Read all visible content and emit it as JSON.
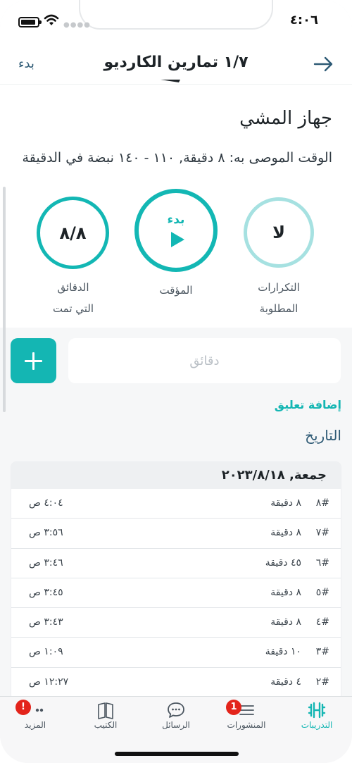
{
  "status_bar": {
    "time": "٤:٠٦"
  },
  "header": {
    "title": "١/٧ تمارين الكارديو",
    "start_label": "بدء"
  },
  "exercise": {
    "name": "جهاز المشي",
    "recommended": "الوقت الموصى به: ٨ دقيقة, ١١٠ - ١٤٠ نبضة في الدقيقة"
  },
  "stats": {
    "reps_value": "لا",
    "reps_caption_line1": "التكرارات",
    "reps_caption_line2": "المطلوبة",
    "timer_label": "بدء",
    "timer_caption": "المؤقت",
    "done_value": "٨/٨",
    "done_caption_line1": "الدقائق",
    "done_caption_line2": "التي تمت"
  },
  "input": {
    "placeholder": "دقائق"
  },
  "add_comment": "إضافة تعليق",
  "history": {
    "title": "التاريخ",
    "date": "جمعة, ٢٠٢٣/٨/١٨",
    "rows": [
      {
        "num": "#٨",
        "duration": "٨ دقيقة",
        "time": "٤:٠٤ ص"
      },
      {
        "num": "#٧",
        "duration": "٨ دقيقة",
        "time": "٣:٥٦ ص"
      },
      {
        "num": "#٦",
        "duration": "٤٥ دقيقة",
        "time": "٣:٤٦ ص"
      },
      {
        "num": "#٥",
        "duration": "٨ دقيقة",
        "time": "٣:٤٥ ص"
      },
      {
        "num": "#٤",
        "duration": "٨ دقيقة",
        "time": "٣:٤٣ ص"
      },
      {
        "num": "#٣",
        "duration": "١٠ دقيقة",
        "time": "١:٠٩ ص"
      },
      {
        "num": "#٢",
        "duration": "٤ دقيقة",
        "time": "١٢:٢٧ ص"
      }
    ]
  },
  "tabs": {
    "workouts": "التدريبات",
    "posts": "المنشورات",
    "posts_badge": "1",
    "messages": "الرسائل",
    "book": "الكتيب",
    "more": "المزيد",
    "more_badge": "!"
  },
  "colors": {
    "accent": "#14b6b3",
    "link": "#2e5a75",
    "badge": "#e3241b"
  },
  "icons": [
    "back-arrow-icon",
    "play-icon",
    "plus-icon",
    "dumbbell-icon",
    "list-icon",
    "chat-bubble-icon",
    "book-icon",
    "more-dots-icon"
  ]
}
